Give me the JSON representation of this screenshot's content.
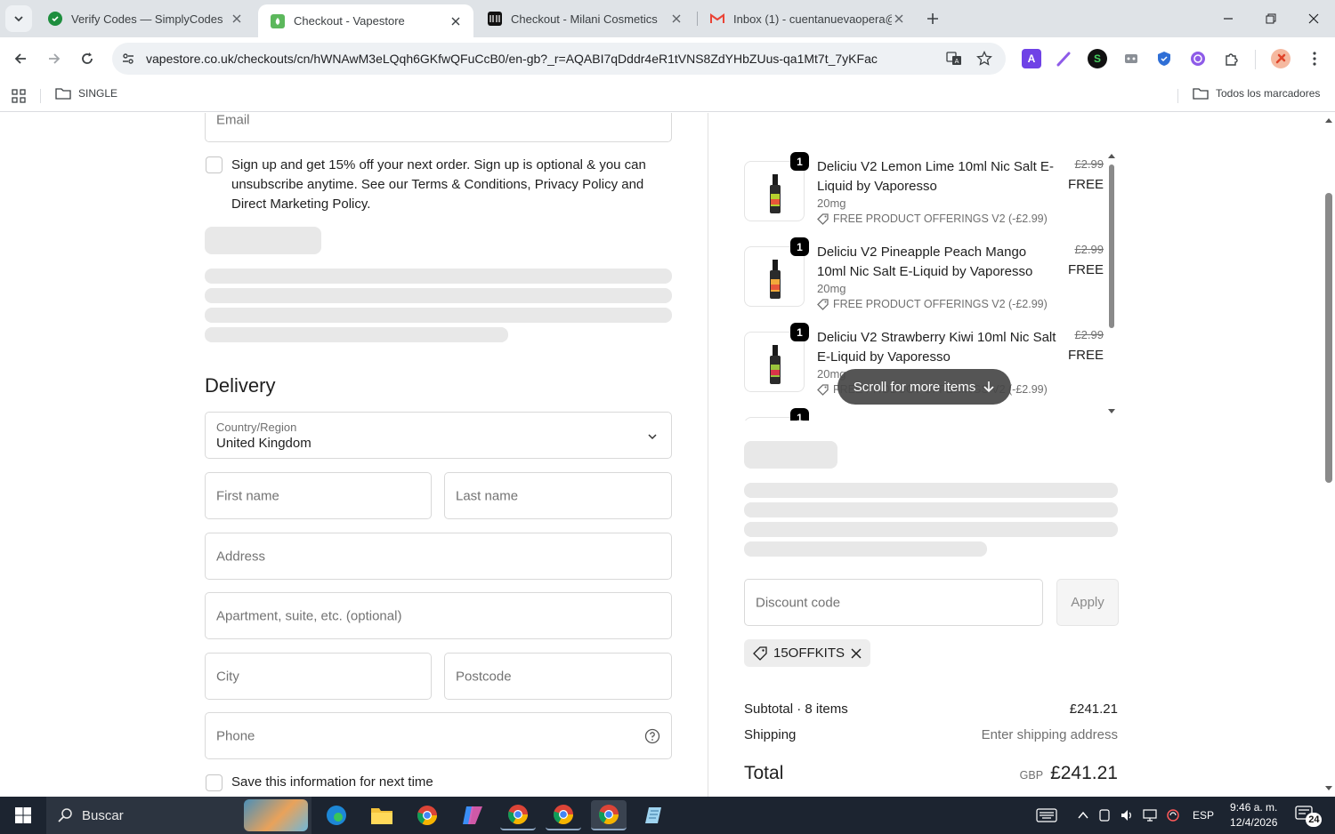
{
  "browser": {
    "tabs": [
      {
        "title": "Verify Codes — SimplyCodes",
        "active": false
      },
      {
        "title": "Checkout - Vapestore",
        "active": true
      },
      {
        "title": "Checkout - Milani Cosmetics",
        "active": false
      },
      {
        "title": "Inbox (1) - cuentanuevaopera@",
        "active": false
      }
    ],
    "url": "vapestore.co.uk/checkouts/cn/hWNAwM3eLQqh6GKfwQFuCcB0/en-gb?_r=AQABI7qDddr4eR1tVNS8ZdYHbZUus-qa1Mt7t_7yKFac",
    "bookmark_folder": "SINGLE",
    "all_bookmarks": "Todos los marcadores"
  },
  "form": {
    "email_placeholder": "Email",
    "signup_text": "Sign up and get 15% off your next order. Sign up is optional & you can unsubscribe anytime. See our Terms & Conditions, Privacy Policy and Direct Marketing Policy.",
    "delivery_heading": "Delivery",
    "country_label": "Country/Region",
    "country_value": "United Kingdom",
    "first_name": "First name",
    "last_name": "Last name",
    "address": "Address",
    "apartment": "Apartment, suite, etc. (optional)",
    "city": "City",
    "postcode": "Postcode",
    "phone": "Phone",
    "save_info": "Save this information for next time"
  },
  "summary": {
    "items": [
      {
        "qty": "1",
        "name": "Deliciu V2 Lemon Lime 10ml Nic Salt E-Liquid by Vaporesso",
        "variant": "20mg",
        "discount": "FREE PRODUCT OFFERINGS V2 (-£2.99)",
        "old_price": "£2.99",
        "price": "FREE"
      },
      {
        "qty": "1",
        "name": "Deliciu V2 Pineapple Peach Mango 10ml Nic Salt E-Liquid by Vaporesso",
        "variant": "20mg",
        "discount": "FREE PRODUCT OFFERINGS V2 (-£2.99)",
        "old_price": "£2.99",
        "price": "FREE"
      },
      {
        "qty": "1",
        "name": "Deliciu V2 Strawberry Kiwi 10ml Nic Salt E-Liquid by Vaporesso",
        "variant": "20mg",
        "discount": "FREE PRODUCT OFFERINGS V2 (-£2.99)",
        "old_price": "£2.99",
        "price": "FREE"
      },
      {
        "qty": "1"
      }
    ],
    "scroll_more": "Scroll for more items",
    "discount_placeholder": "Discount code",
    "apply": "Apply",
    "applied_code": "15OFFKITS",
    "subtotal_label": "Subtotal · 8 items",
    "subtotal_value": "£241.21",
    "shipping_label": "Shipping",
    "shipping_value": "Enter shipping address",
    "total_label": "Total",
    "currency": "GBP",
    "total_value": "£241.21"
  },
  "taskbar": {
    "search_placeholder": "Buscar",
    "lang": "ESP",
    "time": "9:46 a. m.",
    "date": "12/4/2026",
    "notifications": "24"
  },
  "colors": {
    "accent_text": "#1f1f1f",
    "skeleton": "#e8e8e8",
    "taskbar": "#1c2430"
  }
}
